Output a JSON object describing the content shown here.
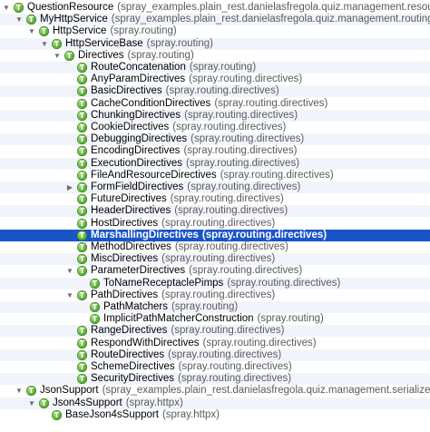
{
  "tree": {
    "nodes": [
      {
        "depth": 0,
        "arrow": "open",
        "name": "QuestionResource",
        "pkg": "(spray_examples.plain_rest.danielasfregola.quiz.management.resources)"
      },
      {
        "depth": 1,
        "arrow": "open",
        "name": "MyHttpService",
        "pkg": "(spray_examples.plain_rest.danielasfregola.quiz.management.routing)"
      },
      {
        "depth": 2,
        "arrow": "open",
        "name": "HttpService",
        "pkg": "(spray.routing)"
      },
      {
        "depth": 3,
        "arrow": "open",
        "name": "HttpServiceBase",
        "pkg": "(spray.routing)"
      },
      {
        "depth": 4,
        "arrow": "open",
        "name": "Directives",
        "pkg": "(spray.routing)"
      },
      {
        "depth": 5,
        "arrow": "none",
        "name": "RouteConcatenation",
        "pkg": "(spray.routing)"
      },
      {
        "depth": 5,
        "arrow": "none",
        "name": "AnyParamDirectives",
        "pkg": "(spray.routing.directives)"
      },
      {
        "depth": 5,
        "arrow": "none",
        "name": "BasicDirectives",
        "pkg": "(spray.routing.directives)"
      },
      {
        "depth": 5,
        "arrow": "none",
        "name": "CacheConditionDirectives",
        "pkg": "(spray.routing.directives)"
      },
      {
        "depth": 5,
        "arrow": "none",
        "name": "ChunkingDirectives",
        "pkg": "(spray.routing.directives)"
      },
      {
        "depth": 5,
        "arrow": "none",
        "name": "CookieDirectives",
        "pkg": "(spray.routing.directives)"
      },
      {
        "depth": 5,
        "arrow": "none",
        "name": "DebuggingDirectives",
        "pkg": "(spray.routing.directives)"
      },
      {
        "depth": 5,
        "arrow": "none",
        "name": "EncodingDirectives",
        "pkg": "(spray.routing.directives)"
      },
      {
        "depth": 5,
        "arrow": "none",
        "name": "ExecutionDirectives",
        "pkg": "(spray.routing.directives)"
      },
      {
        "depth": 5,
        "arrow": "none",
        "name": "FileAndResourceDirectives",
        "pkg": "(spray.routing.directives)"
      },
      {
        "depth": 5,
        "arrow": "closed",
        "name": "FormFieldDirectives",
        "pkg": "(spray.routing.directives)"
      },
      {
        "depth": 5,
        "arrow": "none",
        "name": "FutureDirectives",
        "pkg": "(spray.routing.directives)"
      },
      {
        "depth": 5,
        "arrow": "none",
        "name": "HeaderDirectives",
        "pkg": "(spray.routing.directives)"
      },
      {
        "depth": 5,
        "arrow": "none",
        "name": "HostDirectives",
        "pkg": "(spray.routing.directives)"
      },
      {
        "depth": 5,
        "arrow": "none",
        "name": "MarshallingDirectives",
        "pkg": "(spray.routing.directives)",
        "selected": true
      },
      {
        "depth": 5,
        "arrow": "none",
        "name": "MethodDirectives",
        "pkg": "(spray.routing.directives)"
      },
      {
        "depth": 5,
        "arrow": "none",
        "name": "MiscDirectives",
        "pkg": "(spray.routing.directives)"
      },
      {
        "depth": 5,
        "arrow": "open",
        "name": "ParameterDirectives",
        "pkg": "(spray.routing.directives)"
      },
      {
        "depth": 6,
        "arrow": "none",
        "name": "ToNameReceptaclePimps",
        "pkg": "(spray.routing.directives)"
      },
      {
        "depth": 5,
        "arrow": "open",
        "name": "PathDirectives",
        "pkg": "(spray.routing.directives)"
      },
      {
        "depth": 6,
        "arrow": "none",
        "name": "PathMatchers",
        "pkg": "(spray.routing)"
      },
      {
        "depth": 6,
        "arrow": "none",
        "name": "ImplicitPathMatcherConstruction",
        "pkg": "(spray.routing)"
      },
      {
        "depth": 5,
        "arrow": "none",
        "name": "RangeDirectives",
        "pkg": "(spray.routing.directives)"
      },
      {
        "depth": 5,
        "arrow": "none",
        "name": "RespondWithDirectives",
        "pkg": "(spray.routing.directives)"
      },
      {
        "depth": 5,
        "arrow": "none",
        "name": "RouteDirectives",
        "pkg": "(spray.routing.directives)"
      },
      {
        "depth": 5,
        "arrow": "none",
        "name": "SchemeDirectives",
        "pkg": "(spray.routing.directives)"
      },
      {
        "depth": 5,
        "arrow": "none",
        "name": "SecurityDirectives",
        "pkg": "(spray.routing.directives)"
      },
      {
        "depth": 1,
        "arrow": "open",
        "name": "JsonSupport",
        "pkg": "(spray_examples.plain_rest.danielasfregola.quiz.management.serializers)"
      },
      {
        "depth": 2,
        "arrow": "open",
        "name": "Json4sSupport",
        "pkg": "(spray.httpx)"
      },
      {
        "depth": 3,
        "arrow": "none",
        "name": "BaseJson4sSupport",
        "pkg": "(spray.httpx)"
      }
    ]
  },
  "icons": {
    "trait_letter": "T",
    "arrow_open": "▼",
    "arrow_closed": "▶"
  },
  "colors": {
    "selection": "#1a55c8",
    "trait_icon": "#5fb13a",
    "package_text": "#5a5a5a"
  }
}
